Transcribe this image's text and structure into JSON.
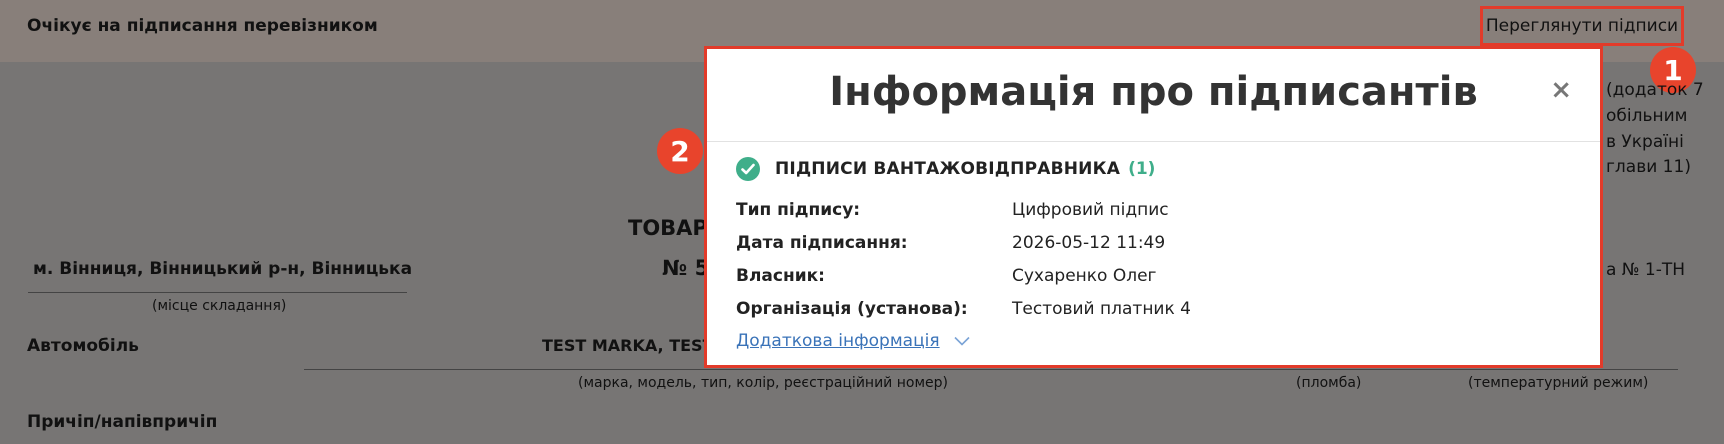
{
  "header": {
    "status": "Очікує на підписання перевізником",
    "view_signatures": "Переглянути підписи"
  },
  "badges": {
    "one": "1",
    "two": "2"
  },
  "document": {
    "right_lines": [
      "(додаток 7",
      "обільним",
      "в Україні",
      "глави 11)"
    ],
    "title_partial": "ТОВАР",
    "number_partial": "№ 5",
    "place_value": "м. Вінниця, Вінницький р-н, Вінницька",
    "place_caption": "(місце складання)",
    "form_partial": "а № 1-ТН",
    "car_label": "Автомобіль",
    "car_value": "TEST MARKA, TEST",
    "car_caption": "(марка, модель, тип, колір, реєстраційний номер)",
    "seal_caption": "(пломба)",
    "temp_caption": "(температурний режим)",
    "trailer_label": "Причіп/напівпричіп"
  },
  "modal": {
    "title": "Інформація про підписантів",
    "close": "×",
    "section_title": "ПІДПИСИ ВАНТАЖОВІДПРАВНИКА",
    "section_count": "(1)",
    "rows": [
      {
        "label": "Тип підпису:",
        "value": "Цифровий підпис"
      },
      {
        "label": "Дата підписання:",
        "value": "2026-05-12 11:49"
      },
      {
        "label": "Власник:",
        "value": "Сухаренко Олег"
      },
      {
        "label": "Організація (установа):",
        "value": "Тестовий платник 4"
      }
    ],
    "more_link": "Додаткова інформація"
  },
  "colors": {
    "accent_red": "#e23b2a",
    "success_green": "#3fae8a",
    "link_blue": "#3a73b8"
  },
  "icons": {
    "close": "close-icon",
    "check": "check-circle-icon",
    "chevron": "chevron-down-icon"
  }
}
